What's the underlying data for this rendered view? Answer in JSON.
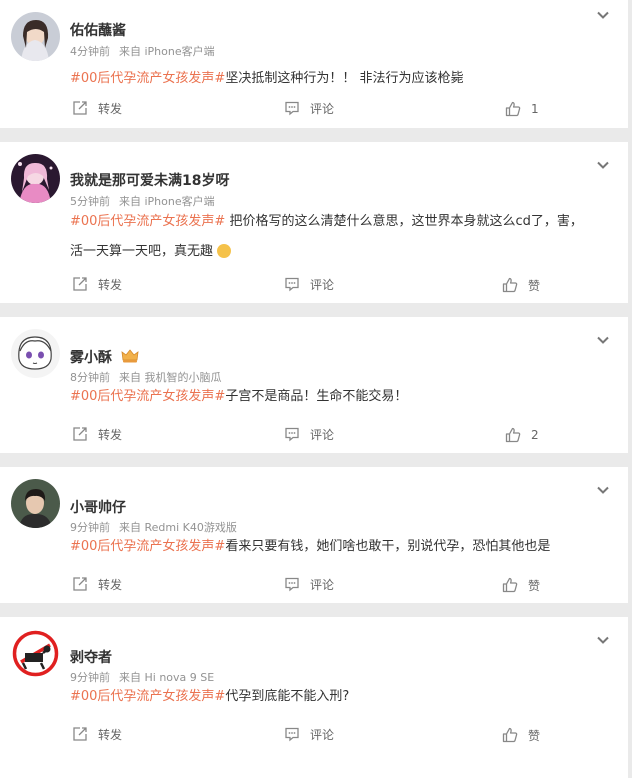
{
  "comments": [
    {
      "user": "佑佑蘸酱",
      "time": "4分钟前",
      "source": "来自 iPhone客户端",
      "hashtag": "#00后代孕流产女孩发声#",
      "text": "坚决抵制这种行为！！ 非法行为应该枪毙",
      "repost_label": "转发",
      "comment_label": "评论",
      "like_label": "1"
    },
    {
      "user": "我就是那可爱未满18岁呀",
      "time": "5分钟前",
      "source": "来自 iPhone客户端",
      "hashtag": "#00后代孕流产女孩发声#",
      "text": " 把价格写的这么清楚什么意思，这世界本身就这么cd了，害，",
      "text2": "活一天算一天吧，真无趣",
      "repost_label": "转发",
      "comment_label": "评论",
      "like_label": "赞"
    },
    {
      "user": "雾小酥",
      "time": "8分钟前",
      "source": "来自 我机智的小脑瓜",
      "hashtag": "#00后代孕流产女孩发声#",
      "text": "子宫不是商品！生命不能交易！",
      "repost_label": "转发",
      "comment_label": "评论",
      "like_label": "2"
    },
    {
      "user": "小哥帅仔",
      "time": "9分钟前",
      "source": "来自 Redmi K40游戏版",
      "hashtag": "#00后代孕流产女孩发声#",
      "text": "看来只要有钱，她们啥也敢干，别说代孕，恐怕其他也是",
      "repost_label": "转发",
      "comment_label": "评论",
      "like_label": "赞"
    },
    {
      "user": "剥夺者",
      "time": "9分钟前",
      "source": "来自 Hi nova 9 SE",
      "hashtag": "#00后代孕流产女孩发声#",
      "text": "代孕到底能不能入刑?",
      "repost_label": "转发",
      "comment_label": "评论",
      "like_label": "赞"
    }
  ],
  "colors": {
    "hashtag": "#eb7350",
    "background": "#eaeaea",
    "card": "#ffffff",
    "meta": "#939393"
  },
  "icons": {
    "more": "chevron-down-icon",
    "repost": "repost-icon",
    "comment": "comment-icon",
    "like": "thumbs-up-icon"
  }
}
